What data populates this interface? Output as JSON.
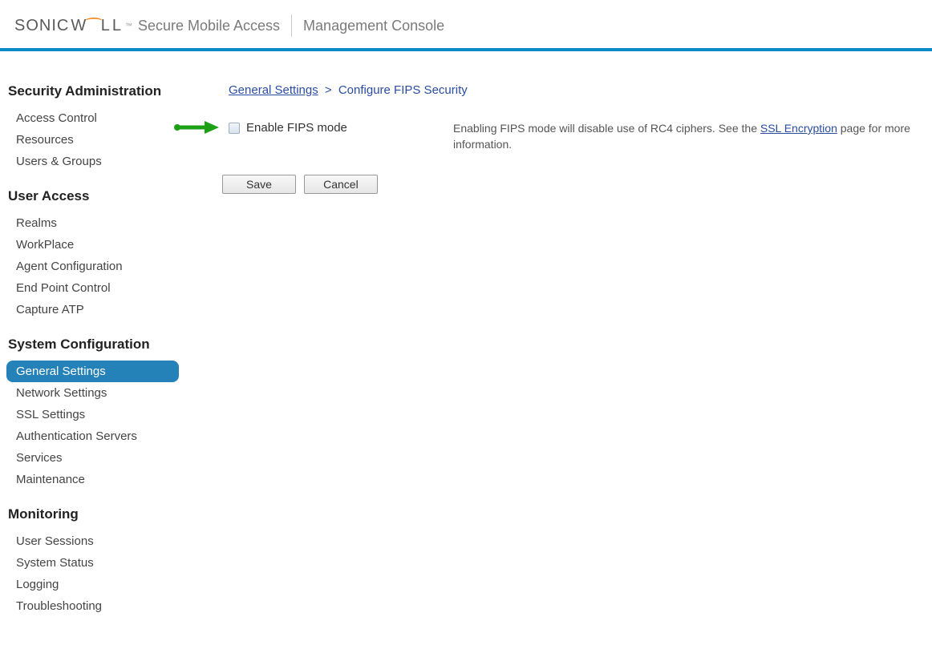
{
  "header": {
    "logo_text_a": "SONIC",
    "logo_text_b": "WALL",
    "product": "Secure Mobile Access",
    "console": "Management Console"
  },
  "sidebar": {
    "sections": [
      {
        "label": "Security Administration",
        "items": [
          "Access Control",
          "Resources",
          "Users & Groups"
        ]
      },
      {
        "label": "User Access",
        "items": [
          "Realms",
          "WorkPlace",
          "Agent Configuration",
          "End Point Control",
          "Capture ATP"
        ]
      },
      {
        "label": "System Configuration",
        "items": [
          "General Settings",
          "Network Settings",
          "SSL Settings",
          "Authentication Servers",
          "Services",
          "Maintenance"
        ],
        "active_index": 0
      },
      {
        "label": "Monitoring",
        "items": [
          "User Sessions",
          "System Status",
          "Logging",
          "Troubleshooting"
        ]
      }
    ]
  },
  "breadcrumb": {
    "link": "General Settings",
    "current": "Configure FIPS Security"
  },
  "form": {
    "checkbox_label": "Enable FIPS mode",
    "checked": false,
    "save_label": "Save",
    "cancel_label": "Cancel"
  },
  "help": {
    "prefix": "Enabling FIPS mode will disable use of RC4 ciphers. See the ",
    "link": "SSL Encryption",
    "suffix": " page for more information."
  }
}
